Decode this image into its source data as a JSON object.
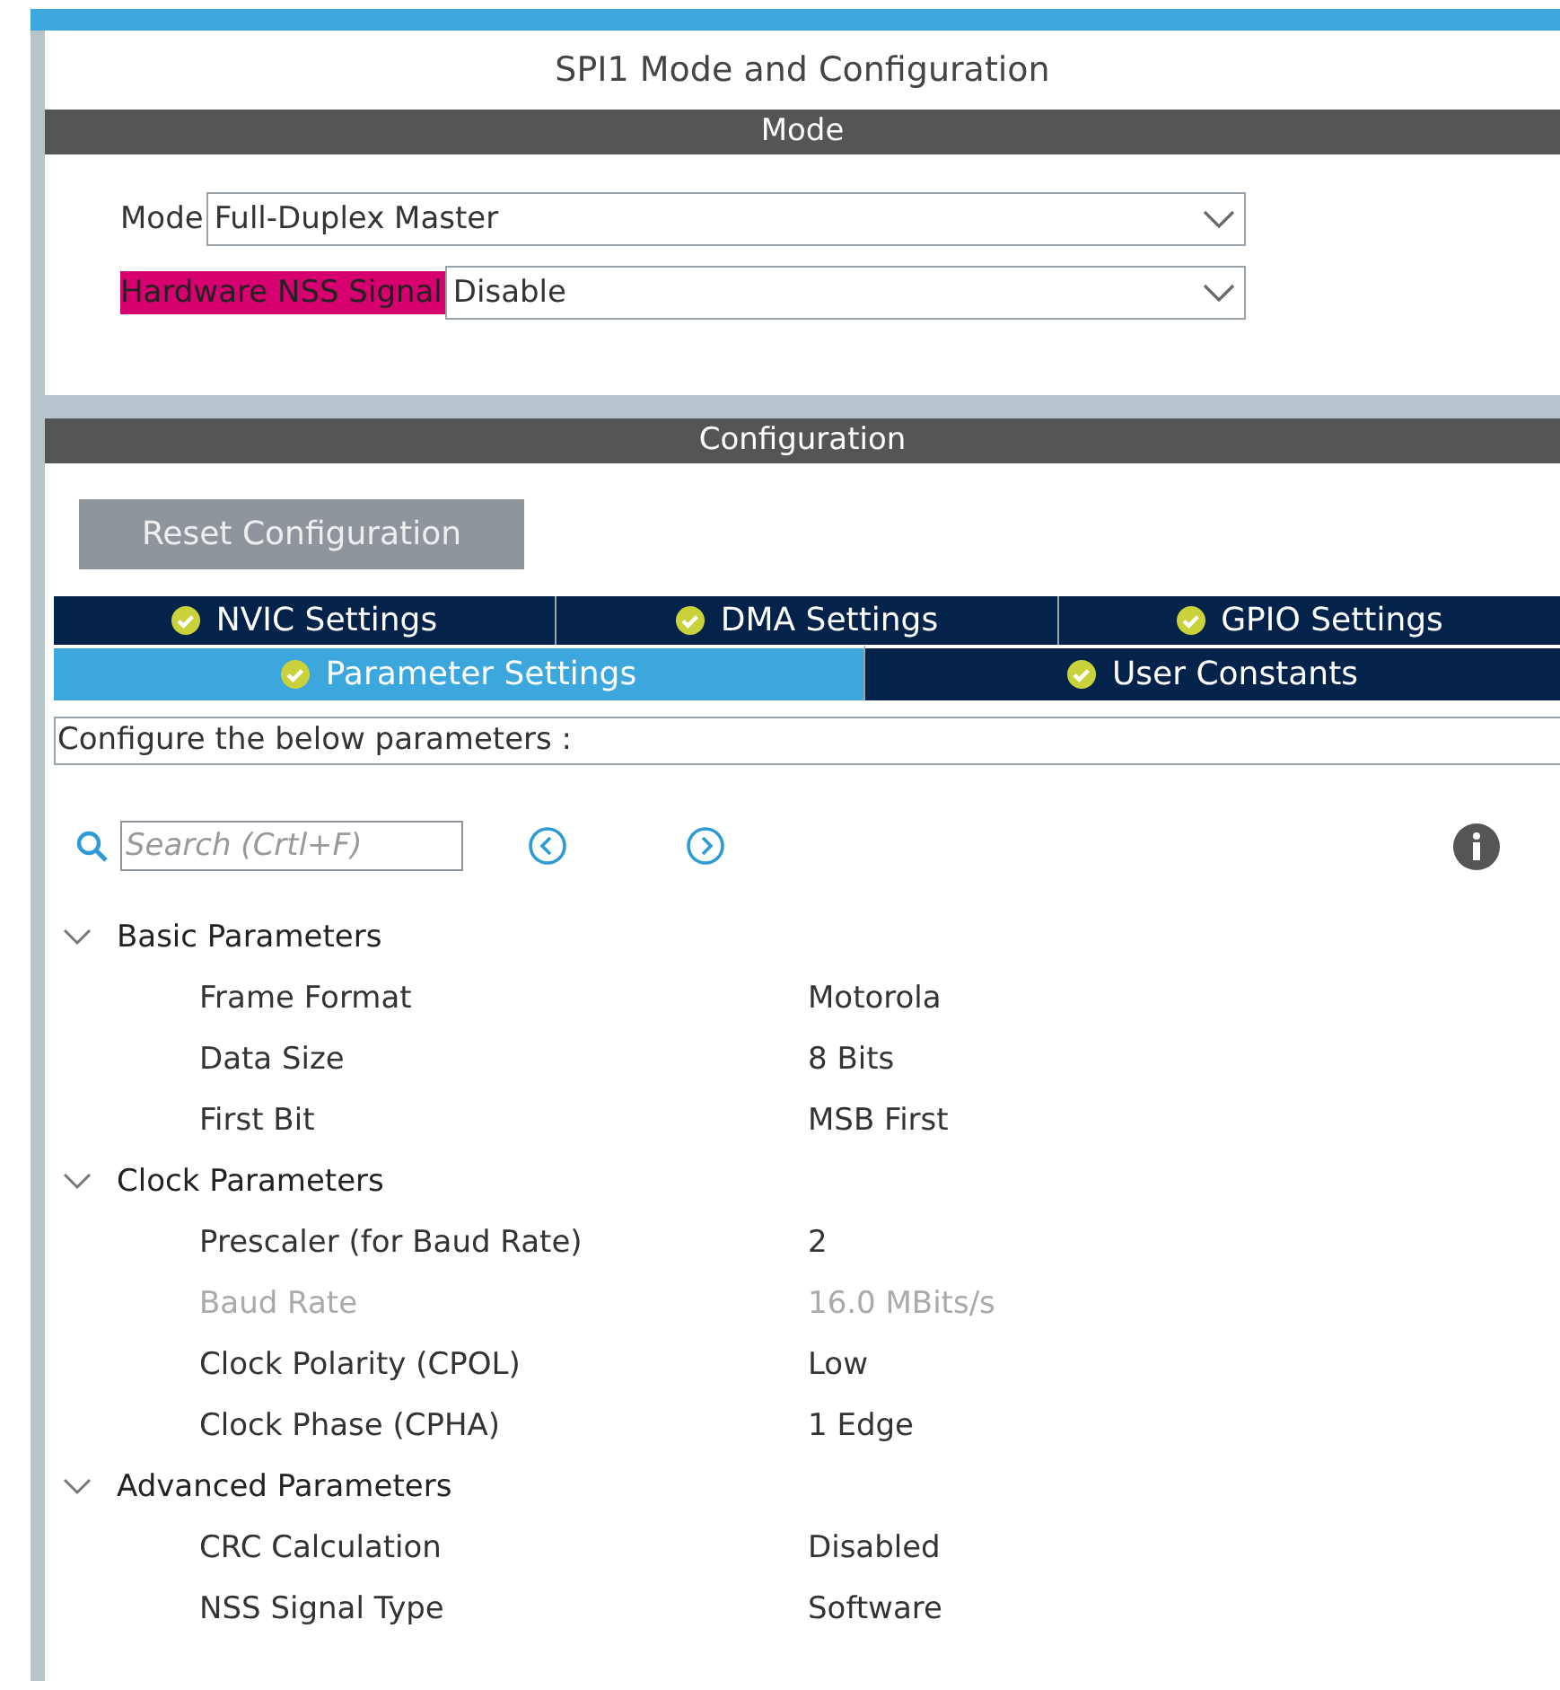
{
  "title": "SPI1 Mode and Configuration",
  "mode_section": {
    "header": "Mode",
    "fields": [
      {
        "label": "Mode",
        "value": "Full-Duplex Master",
        "highlighted": false
      },
      {
        "label": "Hardware NSS Signal",
        "value": "Disable",
        "highlighted": true
      }
    ]
  },
  "configuration_section": {
    "header": "Configuration",
    "reset_button": "Reset Configuration",
    "tab_rows": [
      [
        {
          "label": "NVIC Settings",
          "selected": false
        },
        {
          "label": "DMA Settings",
          "selected": false
        },
        {
          "label": "GPIO Settings",
          "selected": false
        }
      ],
      [
        {
          "label": "Parameter Settings",
          "selected": true
        },
        {
          "label": "User Constants",
          "selected": false
        }
      ]
    ],
    "description": "Configure the below parameters :",
    "search": {
      "placeholder": "Search (Crtl+F)"
    },
    "parameter_groups": [
      {
        "name": "Basic Parameters",
        "expanded": true,
        "children": [
          {
            "name": "Frame Format",
            "value": "Motorola",
            "disabled": false
          },
          {
            "name": "Data Size",
            "value": "8 Bits",
            "disabled": false
          },
          {
            "name": "First Bit",
            "value": "MSB First",
            "disabled": false
          }
        ]
      },
      {
        "name": "Clock Parameters",
        "expanded": true,
        "children": [
          {
            "name": "Prescaler (for Baud Rate)",
            "value": "2",
            "disabled": false
          },
          {
            "name": "Baud Rate",
            "value": "16.0 MBits/s",
            "disabled": true
          },
          {
            "name": "Clock Polarity (CPOL)",
            "value": "Low",
            "disabled": false
          },
          {
            "name": "Clock Phase (CPHA)",
            "value": "1 Edge",
            "disabled": false
          }
        ]
      },
      {
        "name": "Advanced Parameters",
        "expanded": true,
        "children": [
          {
            "name": "CRC Calculation",
            "value": "Disabled",
            "disabled": false
          },
          {
            "name": "NSS Signal Type",
            "value": "Software",
            "disabled": false
          }
        ]
      }
    ]
  }
}
